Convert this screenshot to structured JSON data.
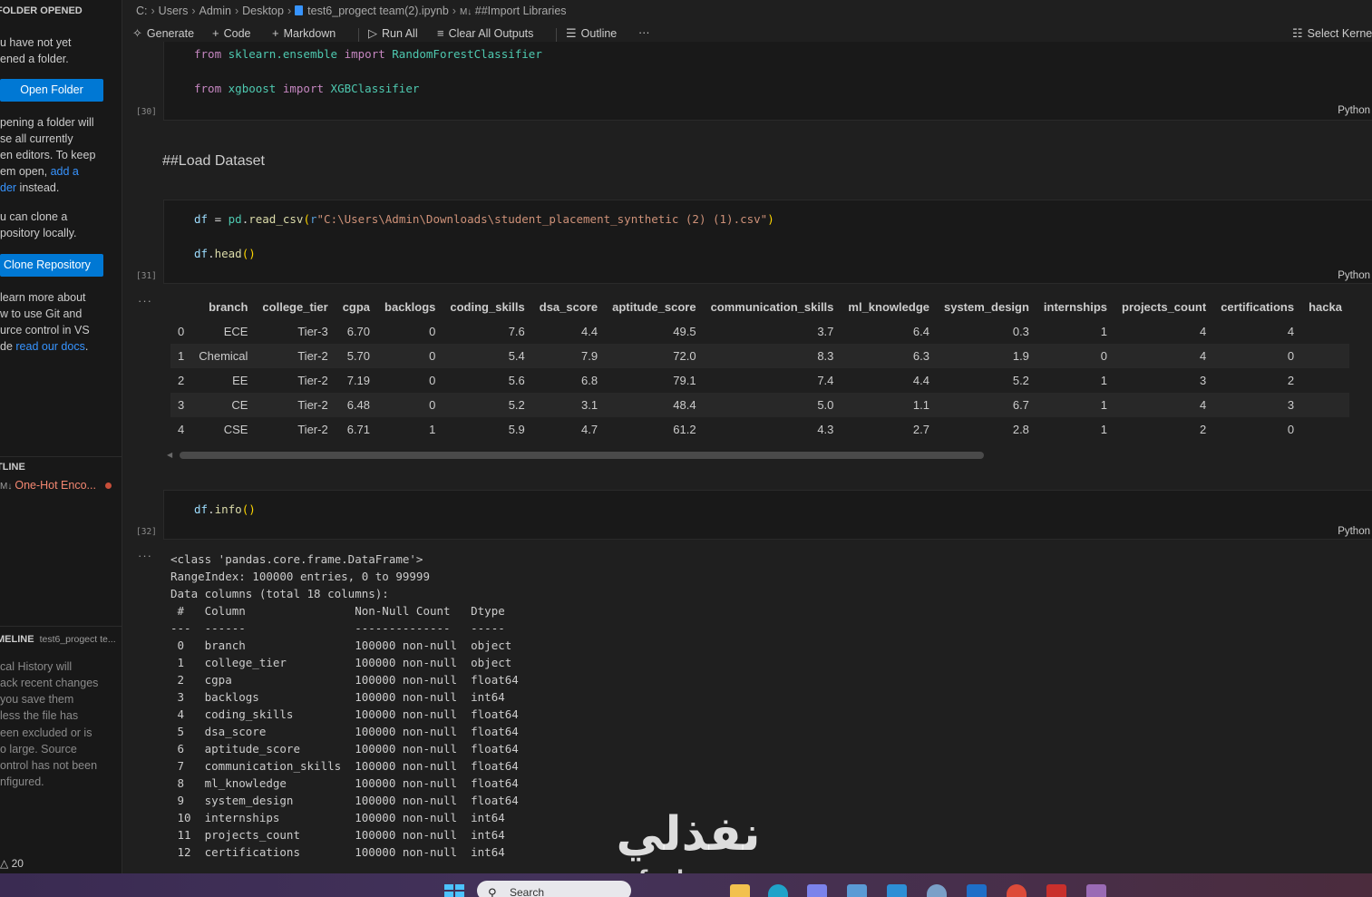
{
  "sidebar": {
    "header": "FOLDER OPENED",
    "no_folder_lines": [
      "u have not yet",
      "ened a folder."
    ],
    "open_folder_button": "Open Folder",
    "opening_lines": [
      "pening a folder will",
      "se all currently",
      "en editors. To keep",
      "em open, "
    ],
    "opening_link1": "add a",
    "opening_link2": "der",
    "opening_tail": " instead.",
    "clone_lines": [
      "u can clone a",
      "pository locally."
    ],
    "clone_button": "Clone Repository",
    "learn_lines": [
      "learn more about",
      "w to use Git and",
      "urce control in VS",
      "de "
    ],
    "learn_link": "read our docs",
    "learn_tail": ".",
    "outline_header": "TLINE",
    "outline_item": "One-Hot Enco...",
    "outline_md": "M↓",
    "timeline_header": "MELINE",
    "timeline_file": "test6_progect te...",
    "timeline_lines": [
      "cal History will",
      "ack recent changes",
      " you save them",
      "less the file has",
      "een excluded or is",
      "o large. Source",
      "ontrol has not been",
      "nfigured."
    ],
    "warning_count": "20"
  },
  "breadcrumb": {
    "parts": [
      "C:",
      "Users",
      "Admin",
      "Desktop"
    ],
    "file": "test6_progect team(2).ipynb",
    "md_marker": "M↓",
    "section": "##Import Libraries"
  },
  "toolbar": {
    "generate": "Generate",
    "code": "Code",
    "markdown": "Markdown",
    "run_all": "Run All",
    "clear_all": "Clear All Outputs",
    "outline": "Outline",
    "more": "···",
    "select_kernel": "Select Kerne"
  },
  "cells": {
    "c30": {
      "exec": "[30]",
      "line1_kw": "from",
      "line1_mod": "sklearn.ensemble",
      "line1_kw2": "import",
      "line1_cls": "RandomForestClassifier",
      "line2_kw": "from",
      "line2_mod": "xgboost",
      "line2_kw2": "import",
      "line2_cls": "XGBClassifier",
      "lang": "Python"
    },
    "markdown_heading": "##Load Dataset",
    "c31": {
      "exec": "[31]",
      "line1_var": "df",
      "line1_eq": " = ",
      "line1_mod": "pd",
      "line1_dot": ".",
      "line1_fn": "read_csv",
      "line1_open": "(",
      "line1_prefix": "r",
      "line1_str": "\"C:\\Users\\Admin\\Downloads\\student_placement_synthetic (2) (1).csv\"",
      "line1_close": ")",
      "line2_var": "df",
      "line2_dot": ".",
      "line2_fn": "head",
      "line2_parens": "()",
      "lang": "Python"
    },
    "c32": {
      "exec": "[32]",
      "line1_var": "df",
      "line1_dot": ".",
      "line1_fn": "info",
      "line1_parens": "()",
      "lang": "Python"
    },
    "output_more": "···"
  },
  "dataframe": {
    "columns": [
      "",
      "branch",
      "college_tier",
      "cgpa",
      "backlogs",
      "coding_skills",
      "dsa_score",
      "aptitude_score",
      "communication_skills",
      "ml_knowledge",
      "system_design",
      "internships",
      "projects_count",
      "certifications",
      "hacka"
    ],
    "rows": [
      [
        "0",
        "ECE",
        "Tier-3",
        "6.70",
        "0",
        "7.6",
        "4.4",
        "49.5",
        "3.7",
        "6.4",
        "0.3",
        "1",
        "4",
        "4",
        ""
      ],
      [
        "1",
        "Chemical",
        "Tier-2",
        "5.70",
        "0",
        "5.4",
        "7.9",
        "72.0",
        "8.3",
        "6.3",
        "1.9",
        "0",
        "4",
        "0",
        ""
      ],
      [
        "2",
        "EE",
        "Tier-2",
        "7.19",
        "0",
        "5.6",
        "6.8",
        "79.1",
        "7.4",
        "4.4",
        "5.2",
        "1",
        "3",
        "2",
        ""
      ],
      [
        "3",
        "CE",
        "Tier-2",
        "6.48",
        "0",
        "5.2",
        "3.1",
        "48.4",
        "5.0",
        "1.1",
        "6.7",
        "1",
        "4",
        "3",
        ""
      ],
      [
        "4",
        "CSE",
        "Tier-2",
        "6.71",
        "1",
        "5.9",
        "4.7",
        "61.2",
        "4.3",
        "2.7",
        "2.8",
        "1",
        "2",
        "0",
        ""
      ]
    ]
  },
  "info_output": "<class 'pandas.core.frame.DataFrame'>\nRangeIndex: 100000 entries, 0 to 99999\nData columns (total 18 columns):\n #   Column                Non-Null Count   Dtype  \n---  ------                --------------   -----  \n 0   branch                100000 non-null  object \n 1   college_tier          100000 non-null  object \n 2   cgpa                  100000 non-null  float64\n 3   backlogs              100000 non-null  int64  \n 4   coding_skills         100000 non-null  float64\n 5   dsa_score             100000 non-null  float64\n 6   aptitude_score        100000 non-null  float64\n 7   communication_skills  100000 non-null  float64\n 8   ml_knowledge          100000 non-null  float64\n 9   system_design         100000 non-null  float64\n 10  internships           100000 non-null  int64  \n 11  projects_count        100000 non-null  int64  \n 12  certifications        100000 non-null  int64  ",
  "watermark": {
    "arabic": "نفذلي",
    "latin": "nofezly.com"
  },
  "taskbar": {
    "search_placeholder": "Search"
  },
  "colors": {
    "accent_button": "#0078d4",
    "link": "#3794ff",
    "outline_modified": "#f48771"
  }
}
